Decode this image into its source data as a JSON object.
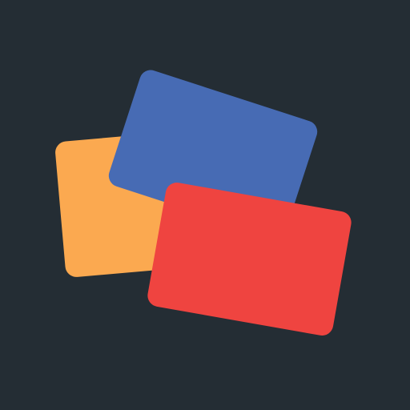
{
  "background_color": "#242D34",
  "cards": [
    {
      "name": "orange-card",
      "color": "#FBA950"
    },
    {
      "name": "blue-card",
      "color": "#476BB4"
    },
    {
      "name": "red-card",
      "color": "#EF4440"
    }
  ]
}
